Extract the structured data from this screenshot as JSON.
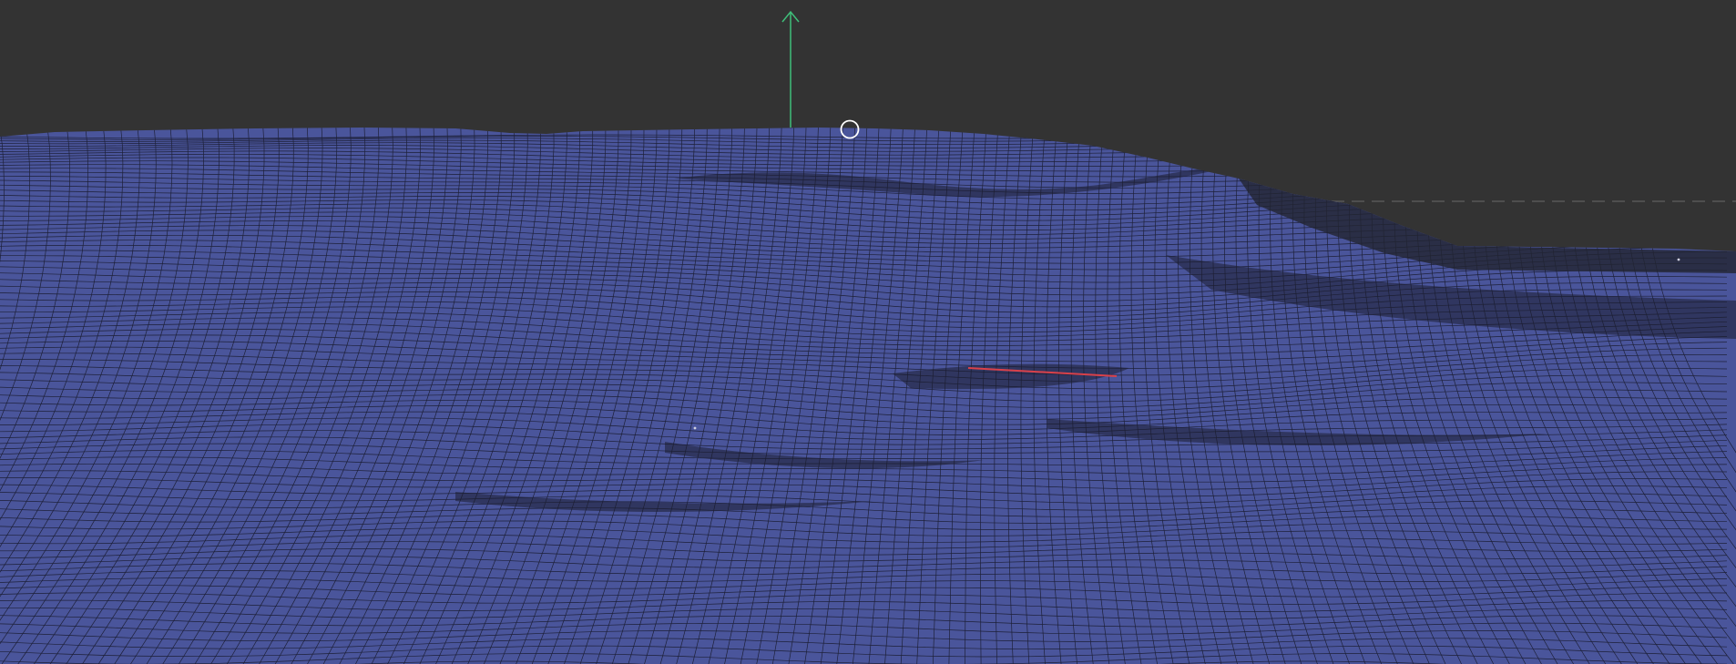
{
  "viewport": {
    "background_color": "#333333",
    "shading_mode": "wireframe-on-shaded",
    "mesh": {
      "fill_color": "#4a559b",
      "wire_color": "#1d2038"
    },
    "gizmo": {
      "y_axis_color": "#3fbf7a",
      "x_axis_color": "#d9414a",
      "pivot_color": "#ffffff"
    },
    "horizon_guide_color": "#6a6a6a"
  }
}
